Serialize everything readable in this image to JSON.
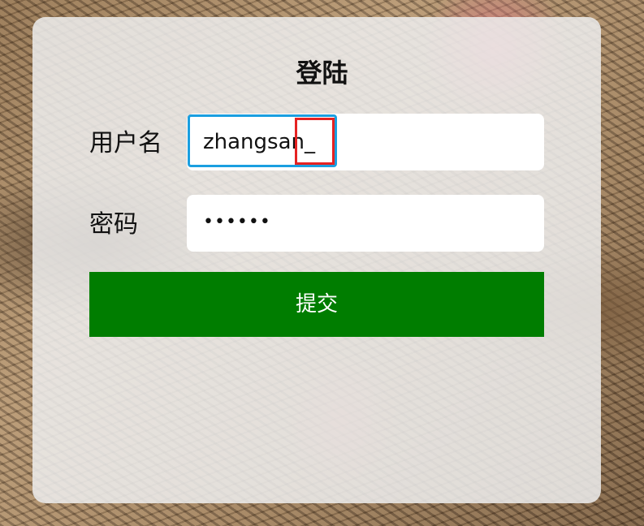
{
  "form": {
    "title": "登陆",
    "username_label": "用户名",
    "username_value": "zhangsan_",
    "password_label": "密码",
    "password_value": "••••••",
    "submit_label": "提交"
  },
  "colors": {
    "submit_bg": "#007d00",
    "focus_ring": "#1a9fe0",
    "cursor_highlight": "#e52222"
  }
}
